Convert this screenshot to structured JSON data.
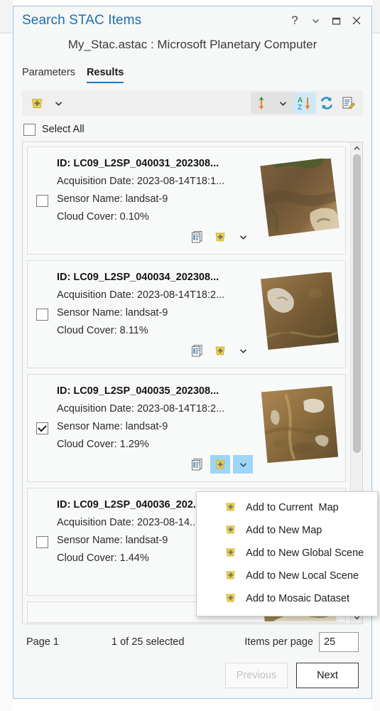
{
  "window": {
    "title": "Search STAC Items",
    "subtitle": "My_Stac.astac : Microsoft Planetary Computer",
    "controls": {
      "help": "?",
      "collapse": "chevron-down",
      "maximize": "maximize",
      "close": "close"
    }
  },
  "tabs": [
    {
      "label": "Parameters",
      "active": false
    },
    {
      "label": "Results",
      "active": true
    }
  ],
  "toolbar": {
    "add_icon": "add-to-map-icon",
    "add_dropdown": "chevron-down-icon",
    "sort_direction_icon": "sort-direction-icon",
    "sort_direction_dropdown": "chevron-down-icon",
    "sort_az_icon": "sort-az-icon",
    "refresh_icon": "refresh-icon",
    "edit_metadata_icon": "edit-metadata-icon"
  },
  "select_all": {
    "label": "Select All",
    "checked": false
  },
  "results": [
    {
      "id_label": "ID: LC09_L2SP_040031_202308...",
      "acquisition_label": "Acquisition Date: 2023-08-14T18:1...",
      "sensor_label": "Sensor Name: landsat-9",
      "cloud_label": "Cloud Cover: 0.10%",
      "checked": false,
      "add_active": false
    },
    {
      "id_label": "ID: LC09_L2SP_040034_202308...",
      "acquisition_label": "Acquisition Date: 2023-08-14T18:2...",
      "sensor_label": "Sensor Name: landsat-9",
      "cloud_label": "Cloud Cover: 8.11%",
      "checked": false,
      "add_active": false
    },
    {
      "id_label": "ID: LC09_L2SP_040035_202308...",
      "acquisition_label": "Acquisition Date: 2023-08-14T18:2...",
      "sensor_label": "Sensor Name: landsat-9",
      "cloud_label": "Cloud Cover: 1.29%",
      "checked": true,
      "add_active": true
    },
    {
      "id_label": "ID: LC09_L2SP_040036_202...",
      "acquisition_label": "Acquisition Date: 2023-08-14...",
      "sensor_label": "Sensor Name: landsat-9",
      "cloud_label": "Cloud Cover: 1.44%",
      "checked": false,
      "add_active": false
    }
  ],
  "add_menu": {
    "open": true,
    "items": [
      "Add to Current  Map",
      "Add to New Map",
      "Add to New Global Scene",
      "Add to New Local Scene",
      "Add to Mosaic Dataset"
    ]
  },
  "footer": {
    "page_label": "Page 1",
    "selection_label": "1 of 25 selected",
    "items_per_page_label": "Items per page",
    "items_per_page_value": "25",
    "previous_label": "Previous",
    "next_label": "Next"
  },
  "colors": {
    "accent": "#1a7bc4",
    "title": "#1a6fb5",
    "highlight": "#9fd5f5",
    "toolbar_highlight": "#cfe8f8",
    "add_icon_yellow": "#ecd24e",
    "dialog_border": "#9dc3e0"
  }
}
